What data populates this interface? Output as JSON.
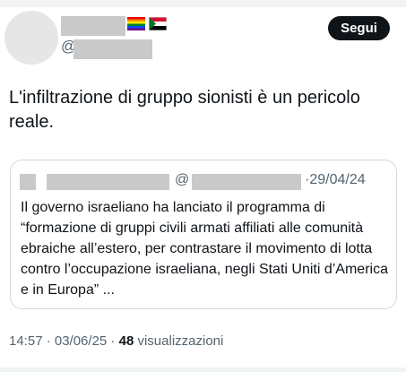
{
  "tweet": {
    "handle_prefix": "@",
    "follow_label": "Segui",
    "text": "L'infiltrazione di gruppo sionisti è un pericolo reale.",
    "flags": [
      "rainbow-flag-icon",
      "sudan-flag-icon"
    ],
    "timestamp": "14:57 · 03/06/25",
    "separator": " · ",
    "views_count": "48",
    "views_label": "visualizzazioni"
  },
  "quote": {
    "at": "@",
    "date": "·29/04/24",
    "text": "Il governo israeliano ha lanciato il programma di “formazione di gruppi civili armati affiliati alle comunità ebraiche all’estero, per contrastare il movimento di lotta contro l’occupazione israeliana, negli Stati Uniti d’America e in Europa” ..."
  },
  "colors": {
    "text_primary": "#0f1419",
    "text_secondary": "#536471",
    "border": "#cfd9de",
    "follow_button": "#0f1419"
  }
}
